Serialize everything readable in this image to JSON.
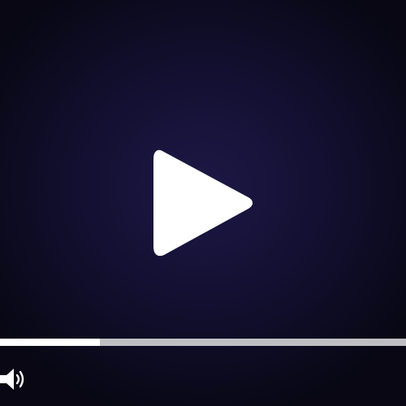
{
  "player": {
    "background_color": "#141033",
    "play_icon": "play-icon",
    "progress_fraction": 0.245,
    "progress_fill_color": "#ffffff",
    "progress_track_color": "#bfbfc3",
    "volume_icon": "volume-icon"
  }
}
